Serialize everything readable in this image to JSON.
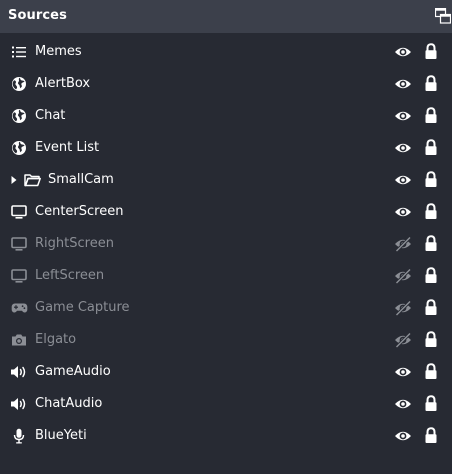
{
  "panel": {
    "title": "Sources",
    "colors": {
      "background": "#272a33",
      "titlebar": "#3c404b",
      "text": "#ffffff",
      "hidden_text": "#8b8e95"
    }
  },
  "sources": [
    {
      "name": "Memes",
      "icon": "list-icon",
      "visible": true,
      "locked": true
    },
    {
      "name": "AlertBox",
      "icon": "globe-icon",
      "visible": true,
      "locked": true
    },
    {
      "name": "Chat",
      "icon": "globe-icon",
      "visible": true,
      "locked": true
    },
    {
      "name": "Event List",
      "icon": "globe-icon",
      "visible": true,
      "locked": true
    },
    {
      "name": "SmallCam",
      "icon": "folder-icon",
      "visible": true,
      "locked": true,
      "group": true,
      "expanded": false
    },
    {
      "name": "CenterScreen",
      "icon": "monitor-icon",
      "visible": true,
      "locked": true
    },
    {
      "name": "RightScreen",
      "icon": "monitor-icon",
      "visible": false,
      "locked": true
    },
    {
      "name": "LeftScreen",
      "icon": "monitor-icon",
      "visible": false,
      "locked": true
    },
    {
      "name": "Game Capture",
      "icon": "gamepad-icon",
      "visible": false,
      "locked": true
    },
    {
      "name": "Elgato",
      "icon": "camera-icon",
      "visible": false,
      "locked": true
    },
    {
      "name": "GameAudio",
      "icon": "speaker-icon",
      "visible": true,
      "locked": true
    },
    {
      "name": "ChatAudio",
      "icon": "speaker-icon",
      "visible": true,
      "locked": true
    },
    {
      "name": "BlueYeti",
      "icon": "microphone-icon",
      "visible": true,
      "locked": true
    }
  ]
}
